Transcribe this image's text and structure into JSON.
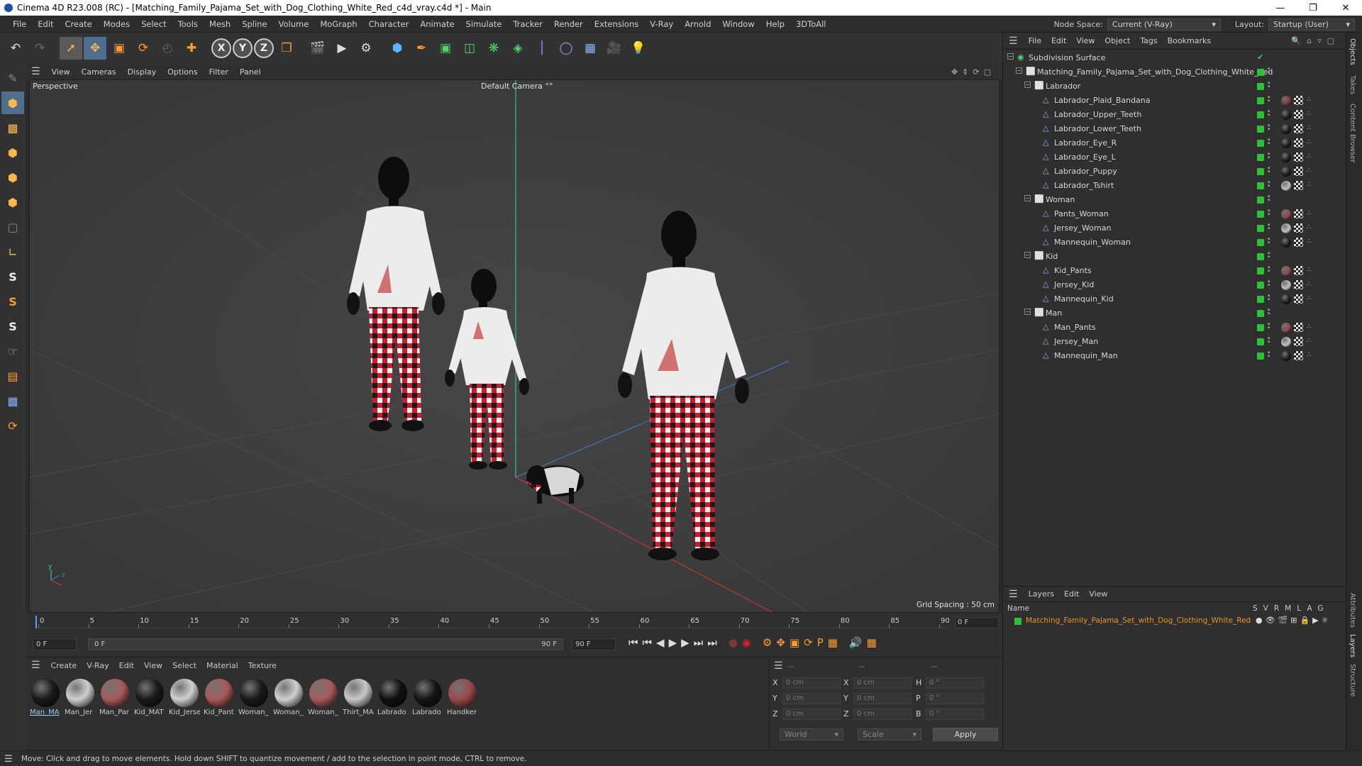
{
  "titlebar": {
    "title": "Cinema 4D R23.008 (RC) - [Matching_Family_Pajama_Set_with_Dog_Clothing_White_Red_c4d_vray.c4d *] - Main"
  },
  "menubar": {
    "items": [
      "File",
      "Edit",
      "Create",
      "Modes",
      "Select",
      "Tools",
      "Mesh",
      "Spline",
      "Volume",
      "MoGraph",
      "Character",
      "Animate",
      "Simulate",
      "Tracker",
      "Render",
      "Extensions",
      "V-Ray",
      "Arnold",
      "Window",
      "Help",
      "3DToAll"
    ],
    "node_space_label": "Node Space:",
    "node_space_value": "Current (V-Ray)",
    "layout_label": "Layout:",
    "layout_value": "Startup (User)"
  },
  "viewport": {
    "menu": [
      "View",
      "Cameras",
      "Display",
      "Options",
      "Filter",
      "Panel"
    ],
    "label": "Perspective",
    "camera": "Default Camera",
    "grid_spacing": "Grid Spacing : 50 cm"
  },
  "timeline": {
    "ticks": [
      "0",
      "5",
      "10",
      "15",
      "20",
      "25",
      "30",
      "35",
      "40",
      "45",
      "50",
      "55",
      "60",
      "65",
      "70",
      "75",
      "80",
      "85",
      "90"
    ],
    "current_frame": "0 F",
    "start_field": "0 F",
    "range_start": "0 F",
    "range_end": "90 F",
    "end_field": "90 F",
    "end_field2": "90 F"
  },
  "materials": {
    "menu": [
      "Create",
      "V-Ray",
      "Edit",
      "View",
      "Select",
      "Material",
      "Texture"
    ],
    "items": [
      {
        "label": "Man_MA",
        "color": "#1a1a1a"
      },
      {
        "label": "Man_Jer",
        "color": "#cfcfcf"
      },
      {
        "label": "Man_Par",
        "color": "#a85a5a"
      },
      {
        "label": "Kid_MAT",
        "color": "#1a1a1a"
      },
      {
        "label": "Kid_Jerse",
        "color": "#cfcfcf"
      },
      {
        "label": "Kid_Pant",
        "color": "#a85a5a"
      },
      {
        "label": "Woman_",
        "color": "#1a1a1a"
      },
      {
        "label": "Woman_",
        "color": "#cfcfcf"
      },
      {
        "label": "Woman_",
        "color": "#a85a5a"
      },
      {
        "label": "Thirt_MA",
        "color": "#c9c9c9"
      },
      {
        "label": "Labrado",
        "color": "#111111"
      },
      {
        "label": "Labrado",
        "color": "#151515"
      },
      {
        "label": "Handker",
        "color": "#9a4a4a"
      }
    ]
  },
  "coords": {
    "header": [
      "--",
      "--",
      "--"
    ],
    "rows": [
      {
        "a": "X",
        "av": "0 cm",
        "b": "X",
        "bv": "0 cm",
        "c": "H",
        "cv": "0 °"
      },
      {
        "a": "Y",
        "av": "0 cm",
        "b": "Y",
        "bv": "0 cm",
        "c": "P",
        "cv": "0 °"
      },
      {
        "a": "Z",
        "av": "0 cm",
        "b": "Z",
        "bv": "0 cm",
        "c": "B",
        "cv": "0 °"
      }
    ],
    "world": "World",
    "scale": "Scale",
    "apply": "Apply"
  },
  "objects": {
    "menu": [
      "File",
      "Edit",
      "View",
      "Object",
      "Tags",
      "Bookmarks"
    ],
    "rows": [
      {
        "name": "Subdivision Surface",
        "indent": 0,
        "type": "subd"
      },
      {
        "name": "Matching_Family_Pajama_Set_with_Dog_Clothing_White_Red",
        "indent": 1,
        "type": "null"
      },
      {
        "name": "Labrador",
        "indent": 2,
        "type": "null"
      },
      {
        "name": "Labrador_Plaid_Bandana",
        "indent": 3,
        "type": "mesh",
        "tag": "#7a3a3a"
      },
      {
        "name": "Labrador_Upper_Teeth",
        "indent": 3,
        "type": "mesh",
        "tag": "#1a1a1a"
      },
      {
        "name": "Labrador_Lower_Teeth",
        "indent": 3,
        "type": "mesh",
        "tag": "#1a1a1a"
      },
      {
        "name": "Labrador_Eye_R",
        "indent": 3,
        "type": "mesh",
        "tag": "#1a1a1a"
      },
      {
        "name": "Labrador_Eye_L",
        "indent": 3,
        "type": "mesh",
        "tag": "#1a1a1a"
      },
      {
        "name": "Labrador_Puppy",
        "indent": 3,
        "type": "mesh",
        "tag": "#1a1a1a"
      },
      {
        "name": "Labrador_Tshirt",
        "indent": 3,
        "type": "mesh",
        "tag": "#bfbfbf"
      },
      {
        "name": "Woman",
        "indent": 2,
        "type": "null"
      },
      {
        "name": "Pants_Woman",
        "indent": 3,
        "type": "mesh",
        "tag": "#8a4a4a"
      },
      {
        "name": "Jersey_Woman",
        "indent": 3,
        "type": "mesh",
        "tag": "#bfbfbf"
      },
      {
        "name": "Mannequin_Woman",
        "indent": 3,
        "type": "mesh",
        "tag": "#1a1a1a"
      },
      {
        "name": "Kid",
        "indent": 2,
        "type": "null"
      },
      {
        "name": "Kid_Pants",
        "indent": 3,
        "type": "mesh",
        "tag": "#8a4a4a"
      },
      {
        "name": "Jersey_Kid",
        "indent": 3,
        "type": "mesh",
        "tag": "#bfbfbf"
      },
      {
        "name": "Mannequin_Kid",
        "indent": 3,
        "type": "mesh",
        "tag": "#1a1a1a"
      },
      {
        "name": "Man",
        "indent": 2,
        "type": "null"
      },
      {
        "name": "Man_Pants",
        "indent": 3,
        "type": "mesh",
        "tag": "#8a4a4a"
      },
      {
        "name": "Jersey_Man",
        "indent": 3,
        "type": "mesh",
        "tag": "#bfbfbf"
      },
      {
        "name": "Mannequin_Man",
        "indent": 3,
        "type": "mesh",
        "tag": "#1a1a1a"
      }
    ]
  },
  "layers": {
    "menu": [
      "Layers",
      "Edit",
      "View"
    ],
    "col_name": "Name",
    "cols": [
      "S",
      "V",
      "R",
      "M",
      "L",
      "A",
      "G"
    ],
    "row": "Matching_Family_Pajama_Set_with_Dog_Clothing_White_Red"
  },
  "righttabs": [
    "Objects",
    "Takes",
    "Content Browser",
    "Attributes",
    "Layers",
    "Structure"
  ],
  "status": "Move: Click and drag to move elements. Hold down SHIFT to quantize movement / add to the selection in point mode, CTRL to remove.",
  "colors": {
    "accent": "#ff9b2e",
    "active_green": "#2fbf3a",
    "layer_text": "#e8941f"
  }
}
